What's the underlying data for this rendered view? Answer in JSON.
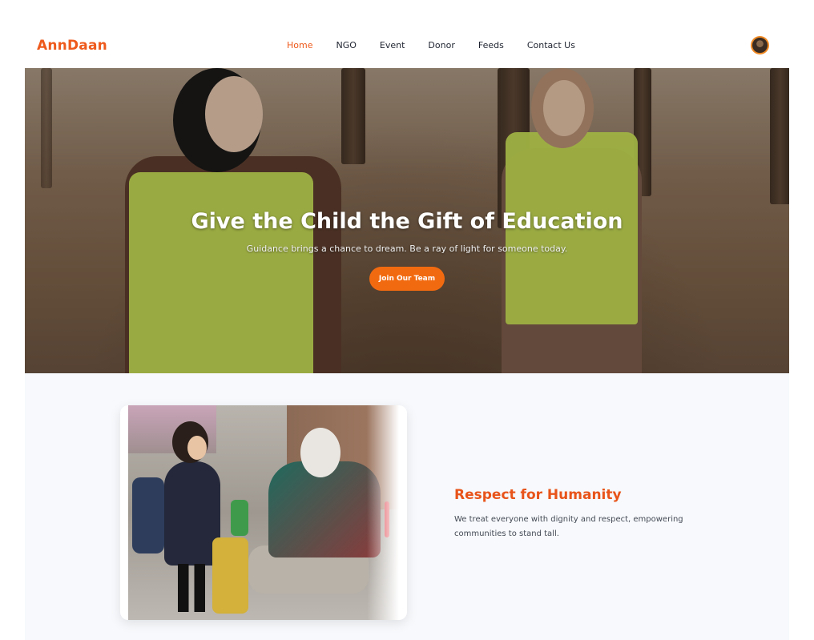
{
  "brand": {
    "name": "AnnDaan",
    "accent_color": "#ee5a1c"
  },
  "nav": {
    "items": [
      {
        "label": "Home",
        "active": true
      },
      {
        "label": "NGO",
        "active": false
      },
      {
        "label": "Event",
        "active": false
      },
      {
        "label": "Donor",
        "active": false
      },
      {
        "label": "Feeds",
        "active": false
      },
      {
        "label": "Contact Us",
        "active": false
      }
    ],
    "avatar_icon": "user-avatar-icon"
  },
  "hero": {
    "title": "Give the Child the Gift of Education",
    "subtitle": "Guidance brings a chance to dream. Be a ray of light for someone today.",
    "cta_label": "Join Our Team",
    "cta_color": "#f26a10"
  },
  "feature": {
    "title": "Respect for Humanity",
    "text": "We treat everyone with dignity and respect, empowering communities to stand tall.",
    "title_color": "#e8541a"
  }
}
